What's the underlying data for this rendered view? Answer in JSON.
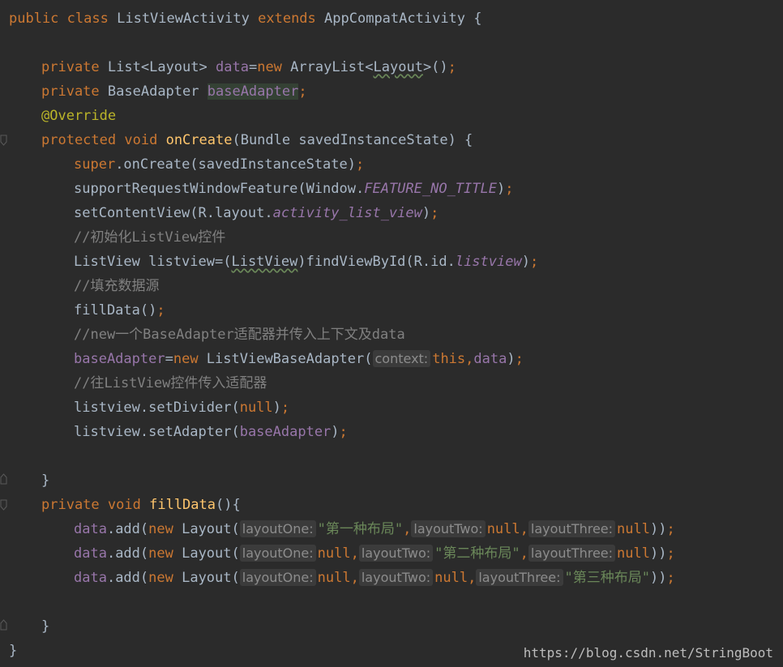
{
  "editor": {
    "theme": "darcula",
    "colors": {
      "background": "#2b2b2b",
      "keyword": "#cc7832",
      "function": "#ffc66d",
      "field": "#9876aa",
      "annotation": "#bbb529",
      "string": "#6a8759",
      "comment": "#808080",
      "text": "#a9b7c6"
    },
    "code": {
      "l1_public": "public",
      "l1_class": "class",
      "l1_name": "ListViewActivity",
      "l1_extends": "extends",
      "l1_parent": "AppCompatActivity",
      "l1_brace": "{",
      "l3_private": "private",
      "l3_type_a": "List<",
      "l3_type_b": "Layout",
      "l3_type_c": "> ",
      "l3_data": "data",
      "l3_eq": "=",
      "l3_new": "new",
      "l3_arraylist": " ArrayList<",
      "l3_layout": "Layout",
      "l3_end_a": ">()",
      "l3_semi": ";",
      "l4_private": "private",
      "l4_type": "BaseAdapter",
      "l4_field": "baseAdapter",
      "l4_semi": ";",
      "l5_annotation": "@Override",
      "l6_protected": "protected",
      "l6_void": "void",
      "l6_fn": "onCreate",
      "l6_params": "(Bundle savedInstanceState) {",
      "l7_super": "super",
      "l7_call": ".onCreate(savedInstanceState)",
      "l7_semi": ";",
      "l8_call": "supportRequestWindowFeature(Window.",
      "l8_const": "FEATURE_NO_TITLE",
      "l8_close": ")",
      "l8_semi": ";",
      "l9_call": "setContentView(R.layout.",
      "l9_const": "activity_list_view",
      "l9_close": ")",
      "l9_semi": ";",
      "l10_comment": "//初始化ListView控件",
      "l11_a": "ListView listview=(",
      "l11_cast": "ListView",
      "l11_b": ")findViewById(R.id.",
      "l11_const": "listview",
      "l11_close": ")",
      "l11_semi": ";",
      "l12_comment": "//填充数据源",
      "l13_call": "fillData()",
      "l13_semi": ";",
      "l14_comment": "//new一个BaseAdapter适配器并传入上下文及data",
      "l15_field": "baseAdapter",
      "l15_eq": "=",
      "l15_new": "new",
      "l15_ctor": " ListViewBaseAdapter(",
      "l15_hint": "context:",
      "l15_this": "this",
      "l15_comma": ",",
      "l15_data": "data",
      "l15_close": ")",
      "l15_semi": ";",
      "l16_comment": "//往ListView控件传入适配器",
      "l17_call": "listview.setDivider(",
      "l17_null": "null",
      "l17_close": ")",
      "l17_semi": ";",
      "l18_call": "listview.setAdapter(",
      "l18_field": "baseAdapter",
      "l18_close": ")",
      "l18_semi": ";",
      "l20_brace": "}",
      "l21_private": "private",
      "l21_void": "void",
      "l21_fn": "fillData",
      "l21_rest": "(){",
      "add_field": "data",
      "add_call": ".add(",
      "add_new": "new",
      "add_ctor": " Layout(",
      "hint_one": "layoutOne:",
      "hint_two": "layoutTwo:",
      "hint_three": "layoutThree:",
      "comma": ",",
      "null": "null",
      "add_end": "))",
      "add_semi": ";",
      "str_one": "\"第一种布局\"",
      "str_two": "\"第二种布局\"",
      "str_three": "\"第三种布局\"",
      "l26_brace": "}",
      "l27_brace": "}"
    }
  },
  "watermark": "https://blog.csdn.net/StringBoot"
}
